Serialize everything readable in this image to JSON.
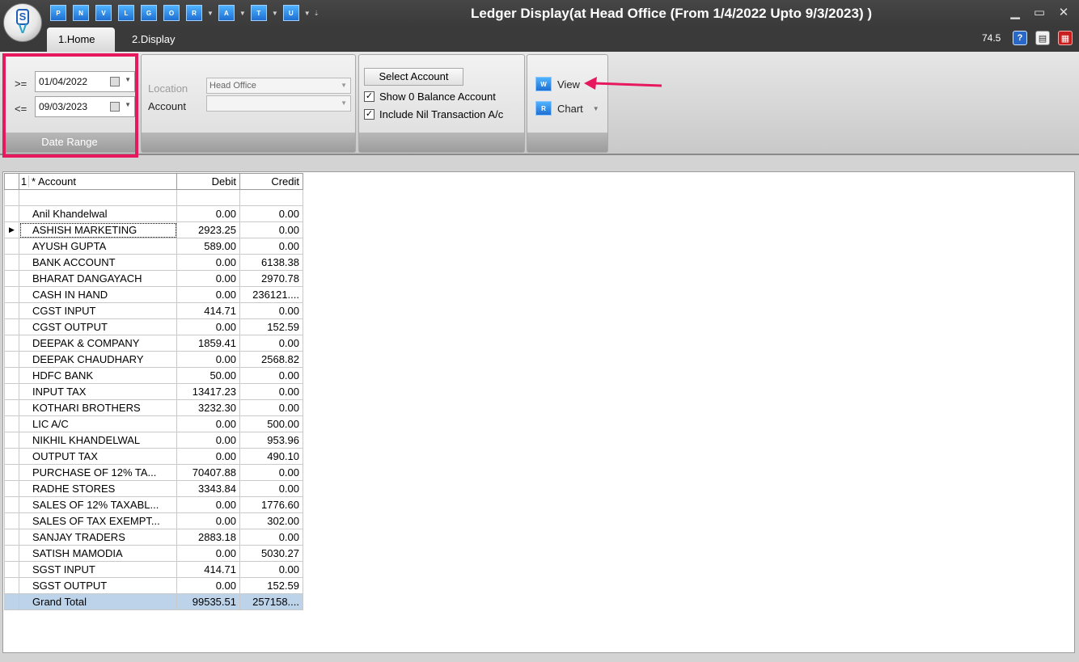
{
  "window": {
    "title": "Ledger Display(at Head Office  (From 1/4/2022 Upto 9/3/2023) )",
    "zoom": "74.5"
  },
  "quick_access": [
    "P",
    "N",
    "V",
    "L",
    "G",
    "O",
    "R",
    "A",
    "T",
    "U"
  ],
  "tabs": [
    {
      "label": "1.Home",
      "active": true
    },
    {
      "label": "2.Display",
      "active": false
    }
  ],
  "ribbon": {
    "date_range": {
      "from_op": ">=",
      "from_value": "01/04/2022",
      "to_op": "<=",
      "to_value": "09/03/2023",
      "group_label": "Date Range"
    },
    "filters": {
      "location_label": "Location",
      "location_value": "Head Office",
      "account_label": "Account",
      "account_value": ""
    },
    "options": {
      "select_account_label": "Select Account",
      "show_zero_balance_label": "Show 0 Balance Account",
      "show_zero_balance_checked": true,
      "include_nil_label": "Include Nil Transaction A/c",
      "include_nil_checked": true
    },
    "actions": {
      "view_label": "View",
      "view_icon": "W",
      "chart_label": "Chart",
      "chart_icon": "R"
    }
  },
  "grid": {
    "headers": {
      "index": "1",
      "star": "*",
      "account": "Account",
      "debit": "Debit",
      "credit": "Credit"
    },
    "rows": [
      {
        "account": "Anil Khandelwal",
        "debit": "0.00",
        "credit": "0.00"
      },
      {
        "account": "ASHISH MARKETING",
        "debit": "2923.25",
        "credit": "0.00"
      },
      {
        "account": "AYUSH GUPTA",
        "debit": "589.00",
        "credit": "0.00"
      },
      {
        "account": "BANK ACCOUNT",
        "debit": "0.00",
        "credit": "6138.38"
      },
      {
        "account": "BHARAT DANGAYACH",
        "debit": "0.00",
        "credit": "2970.78"
      },
      {
        "account": "CASH IN HAND",
        "debit": "0.00",
        "credit": "236121...."
      },
      {
        "account": "CGST INPUT",
        "debit": "414.71",
        "credit": "0.00"
      },
      {
        "account": "CGST OUTPUT",
        "debit": "0.00",
        "credit": "152.59"
      },
      {
        "account": "DEEPAK & COMPANY",
        "debit": "1859.41",
        "credit": "0.00"
      },
      {
        "account": "DEEPAK CHAUDHARY",
        "debit": "0.00",
        "credit": "2568.82"
      },
      {
        "account": "HDFC BANK",
        "debit": "50.00",
        "credit": "0.00"
      },
      {
        "account": "INPUT TAX",
        "debit": "13417.23",
        "credit": "0.00"
      },
      {
        "account": "KOTHARI BROTHERS",
        "debit": "3232.30",
        "credit": "0.00"
      },
      {
        "account": "LIC A/C",
        "debit": "0.00",
        "credit": "500.00"
      },
      {
        "account": "NIKHIL KHANDELWAL",
        "debit": "0.00",
        "credit": "953.96"
      },
      {
        "account": "OUTPUT TAX",
        "debit": "0.00",
        "credit": "490.10"
      },
      {
        "account": "PURCHASE OF 12% TA...",
        "debit": "70407.88",
        "credit": "0.00"
      },
      {
        "account": "RADHE STORES",
        "debit": "3343.84",
        "credit": "0.00"
      },
      {
        "account": "SALES OF 12% TAXABL...",
        "debit": "0.00",
        "credit": "1776.60"
      },
      {
        "account": "SALES OF TAX EXEMPT...",
        "debit": "0.00",
        "credit": "302.00"
      },
      {
        "account": "SANJAY TRADERS",
        "debit": "2883.18",
        "credit": "0.00"
      },
      {
        "account": "SATISH MAMODIA",
        "debit": "0.00",
        "credit": "5030.27"
      },
      {
        "account": "SGST INPUT",
        "debit": "414.71",
        "credit": "0.00"
      },
      {
        "account": "SGST OUTPUT",
        "debit": "0.00",
        "credit": "152.59"
      }
    ],
    "selected_row_index": 1,
    "total": {
      "account": "Grand Total",
      "debit": "99535.51",
      "credit": "257158...."
    }
  },
  "colors": {
    "highlight": "#e7185d",
    "total_row": "#bcd3ea",
    "accent_blue": "#1f6fd1"
  }
}
